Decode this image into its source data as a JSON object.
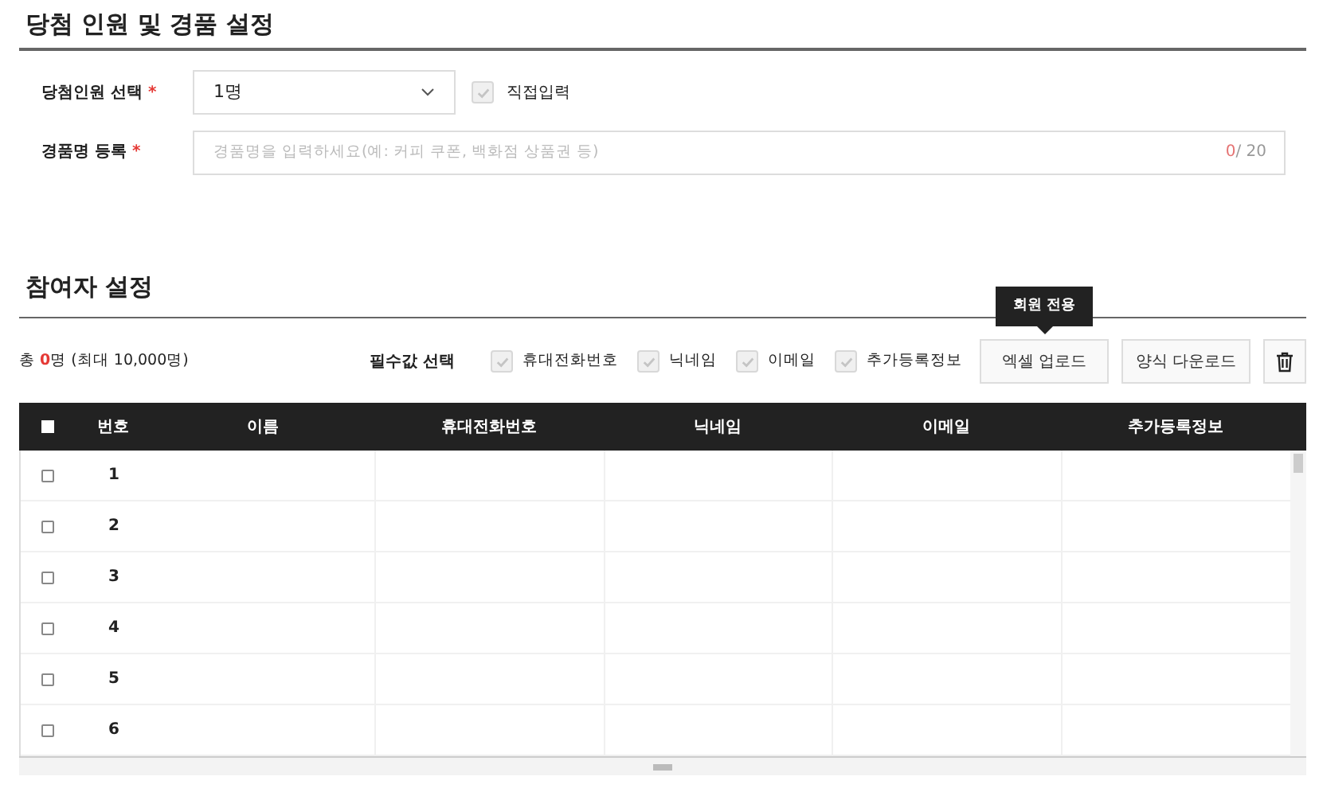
{
  "winner_section": {
    "title": "당첨 인원 및 경품 설정",
    "count_field": {
      "label": "당첨인원 선택",
      "required_mark": "*",
      "value": "1명",
      "manual": {
        "label": "직접입력",
        "checked": true
      }
    },
    "prize_field": {
      "label": "경품명 등록",
      "required_mark": "*",
      "placeholder": "경품명을 입력하세요(예: 커피 쿠폰, 백화점 상품권 등)",
      "count": "0",
      "limit": "/ 20"
    }
  },
  "participant_section": {
    "title": "참여자 설정",
    "total": {
      "prefix": "총",
      "count": "0",
      "suffix": "명 (최대 10,000명)"
    },
    "required_label": "필수값 선택",
    "required_options": [
      {
        "label": "휴대전화번호",
        "checked": true
      },
      {
        "label": "닉네임",
        "checked": true
      },
      {
        "label": "이메일",
        "checked": true
      },
      {
        "label": "추가등록정보",
        "checked": true
      }
    ],
    "tooltip": "회원 전용",
    "buttons": [
      "엑셀 업로드",
      "양식 다운로드"
    ],
    "table": {
      "select_all_checked": false,
      "columns": [
        "번호",
        "이름",
        "휴대전화번호",
        "닉네임",
        "이메일",
        "추가등록정보"
      ],
      "rows": [
        {
          "number": "1",
          "checked": false
        },
        {
          "number": "2",
          "checked": false
        },
        {
          "number": "3",
          "checked": false
        },
        {
          "number": "4",
          "checked": false
        },
        {
          "number": "5",
          "checked": false
        },
        {
          "number": "6",
          "checked": false
        }
      ]
    }
  }
}
